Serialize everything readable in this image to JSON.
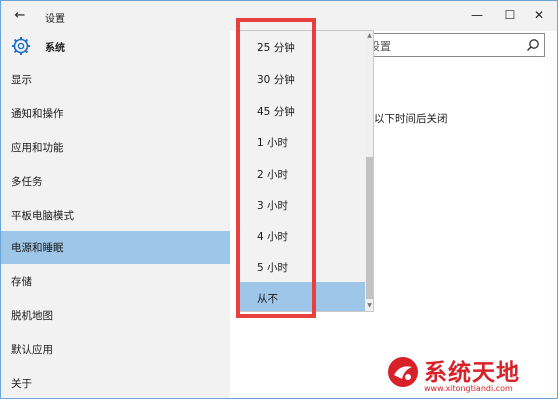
{
  "window": {
    "title": "设置"
  },
  "titlebar": {
    "back_glyph": "←",
    "minimize_glyph": "—",
    "maximize_glyph": "☐",
    "close_glyph": "✕"
  },
  "sidebar": {
    "header_label": "系统",
    "items": [
      {
        "label": "显示"
      },
      {
        "label": "通知和操作"
      },
      {
        "label": "应用和功能"
      },
      {
        "label": "多任务"
      },
      {
        "label": "平板电脑模式"
      },
      {
        "label": "电源和睡眠",
        "selected": true
      },
      {
        "label": "存储"
      },
      {
        "label": "脱机地图"
      },
      {
        "label": "默认应用"
      },
      {
        "label": "关于"
      }
    ]
  },
  "search": {
    "partial_text": "设置"
  },
  "main": {
    "partial_text": "以下时间后关闭"
  },
  "dropdown": {
    "options": [
      {
        "label": "25 分钟"
      },
      {
        "label": "30 分钟"
      },
      {
        "label": "45 分钟"
      },
      {
        "label": "1 小时"
      },
      {
        "label": "2 小时"
      },
      {
        "label": "3 小时"
      },
      {
        "label": "4 小时"
      },
      {
        "label": "5 小时"
      },
      {
        "label": "从不",
        "selected": true
      }
    ]
  },
  "watermark": {
    "title": "系统天地",
    "url": "www.xitongtiandi.com"
  },
  "colors": {
    "accent": "#9ec6e8",
    "highlight": "#e8403e",
    "sidebar_bg": "#f2f2f2",
    "brand_red": "#d8222a"
  }
}
